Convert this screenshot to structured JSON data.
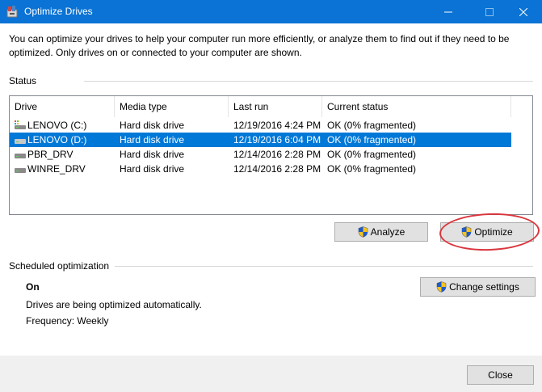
{
  "window": {
    "title": "Optimize Drives",
    "minimize_icon": "minimize-icon",
    "maximize_icon": "maximize-icon",
    "close_icon": "close-icon"
  },
  "intro": "You can optimize your drives to help your computer run more efficiently, or analyze them to find out if they need to be optimized. Only drives on or connected to your computer are shown.",
  "status": {
    "label": "Status",
    "columns": [
      "Drive",
      "Media type",
      "Last run",
      "Current status"
    ],
    "drives": [
      {
        "name": "LENOVO  (C:)",
        "icon": "system-drive-icon",
        "media": "Hard disk drive",
        "last_run": "12/19/2016 4:24 PM",
        "status": "OK (0% fragmented)",
        "selected": false
      },
      {
        "name": "LENOVO (D:)",
        "icon": "hard-drive-icon",
        "media": "Hard disk drive",
        "last_run": "12/19/2016 6:04 PM",
        "status": "OK (0% fragmented)",
        "selected": true
      },
      {
        "name": "PBR_DRV",
        "icon": "hard-drive-icon",
        "media": "Hard disk drive",
        "last_run": "12/14/2016 2:28 PM",
        "status": "OK (0% fragmented)",
        "selected": false
      },
      {
        "name": "WINRE_DRV",
        "icon": "hard-drive-icon",
        "media": "Hard disk drive",
        "last_run": "12/14/2016 2:28 PM",
        "status": "OK (0% fragmented)",
        "selected": false
      }
    ],
    "analyze_label": "Analyze",
    "optimize_label": "Optimize"
  },
  "scheduled": {
    "label": "Scheduled optimization",
    "state": "On",
    "description": "Drives are being optimized automatically.",
    "frequency": "Frequency: Weekly",
    "change_label": "Change settings"
  },
  "footer": {
    "close_label": "Close"
  },
  "colors": {
    "title_bar": "#0a73d5",
    "selection": "#0078d7",
    "highlight_circle": "#d9363e",
    "shield_blue": "#1f5bc6",
    "shield_yellow": "#f6c320"
  }
}
